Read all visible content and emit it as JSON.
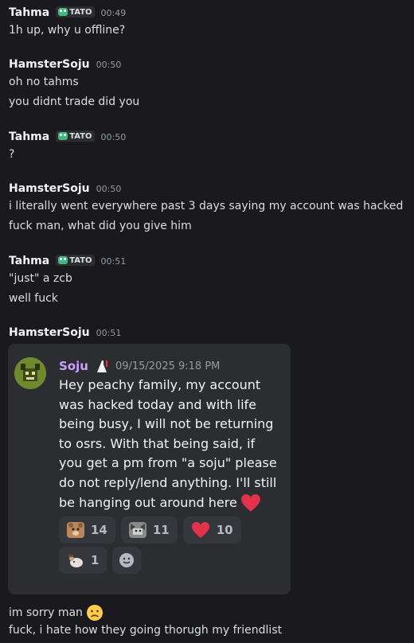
{
  "messages": [
    {
      "author": "Tahma",
      "tag": "TATO",
      "time": "00:49",
      "lines": [
        "1h up, why u offline?"
      ]
    },
    {
      "author": "HamsterSoju",
      "time": "00:50",
      "lines": [
        "oh no tahms",
        "you didnt trade did you"
      ]
    },
    {
      "author": "Tahma",
      "tag": "TATO",
      "time": "00:50",
      "lines": [
        "?"
      ]
    },
    {
      "author": "HamsterSoju",
      "time": "00:50",
      "lines": [
        "i literally went everywhere past 3 days saying my account was hacked",
        "fuck man, what did you give him"
      ]
    },
    {
      "author": "Tahma",
      "tag": "TATO",
      "time": "00:51",
      "lines": [
        "\"just\" a zcb",
        "well fuck"
      ]
    },
    {
      "author": "HamsterSoju",
      "time": "00:51"
    }
  ],
  "forwarded": {
    "name": "Soju",
    "date": "09/15/2025 9:18 PM",
    "lines": [
      "Hey peachy family, my account",
      "was hacked today and with life",
      "being busy, I will not be returning",
      "to osrs. With that being said, if",
      "you get a pm from \"a soju\" please",
      "do not reply/lend anything. I'll still",
      "be hanging out around here"
    ],
    "reactions": [
      {
        "icon": "bear-emoji",
        "count": "14"
      },
      {
        "icon": "cat-emoji",
        "count": "11"
      },
      {
        "icon": "heart-emoji",
        "count": "10"
      },
      {
        "icon": "hamster-emoji",
        "count": "1"
      }
    ]
  },
  "after": [
    "im sorry man",
    "fuck, i hate how they going thorugh my friendlist"
  ],
  "colors": {
    "background": "#1a1a1e",
    "accent_name": "#c9a0ff",
    "heart": "#e5324b"
  }
}
